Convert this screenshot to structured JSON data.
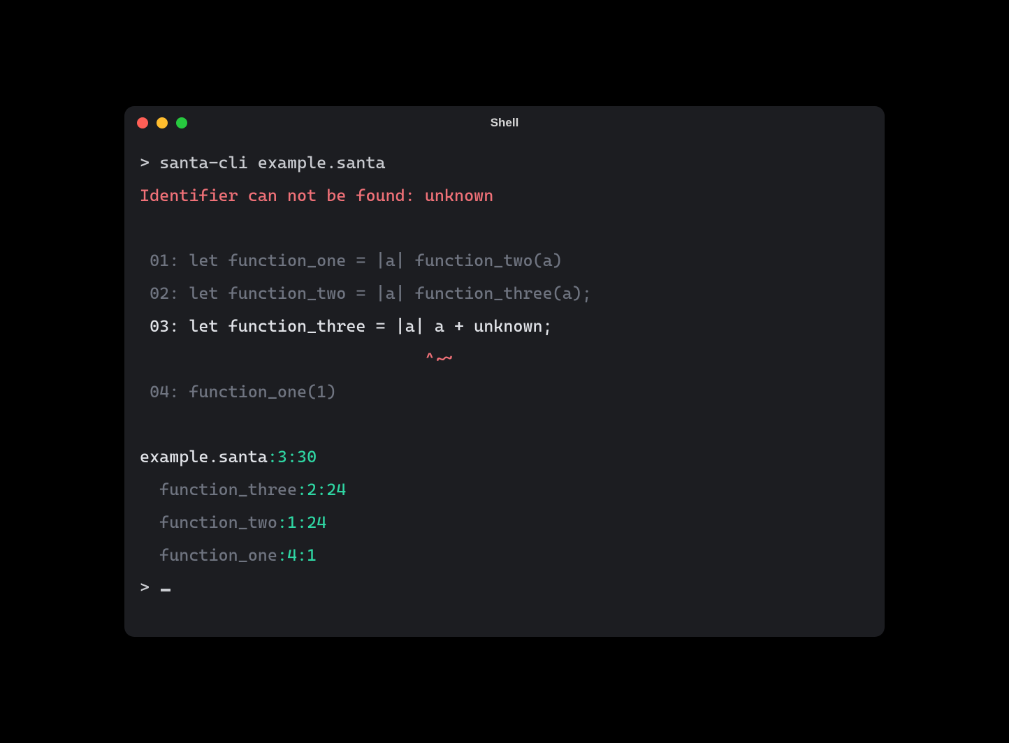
{
  "window": {
    "title": "Shell"
  },
  "prompt": {
    "symbol": ">",
    "command": "santa-cli example.santa"
  },
  "error": {
    "message": "Identifier can not be found: unknown"
  },
  "code": {
    "indent": " ",
    "squiggle_indent": "                             ",
    "squiggle": "^~~",
    "lines": [
      {
        "num": "01:",
        "text": "let function_one = |a| function_two(a)",
        "highlight": false
      },
      {
        "num": "02:",
        "text": "let function_two = |a| function_three(a);",
        "highlight": false
      },
      {
        "num": "03:",
        "text": "let function_three = |a| a + unknown;",
        "highlight": true
      },
      {
        "num": "04:",
        "text": "function_one(1)",
        "highlight": false
      }
    ]
  },
  "trace": {
    "file": {
      "name": "example.santa",
      "sep": ":",
      "loc": "3:30"
    },
    "frames": [
      {
        "indent": "  ",
        "name": "function_three",
        "sep": ":",
        "loc": "2:24"
      },
      {
        "indent": "  ",
        "name": "function_two",
        "sep": ":",
        "loc": "1:24"
      },
      {
        "indent": "  ",
        "name": "function_one",
        "sep": ":",
        "loc": "4:1"
      }
    ]
  },
  "prompt2": {
    "symbol": ">"
  }
}
